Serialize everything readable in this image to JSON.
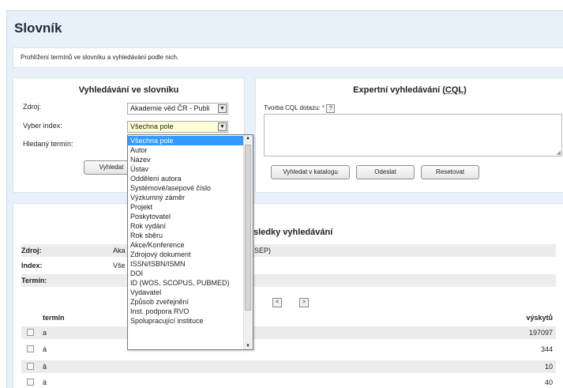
{
  "header": {
    "title": "Slovník"
  },
  "intro": {
    "text": "Prohlížení termínů ve slovníku a vyhledávání podle nich."
  },
  "simple_search": {
    "title": "Vyhledávání ve slovníku",
    "source_label": "Zdroj:",
    "source_value": "Akademie věd ČR - Publi",
    "index_label": "Vyber index:",
    "index_value": "Všechna pole",
    "term_label": "Hledaný termín:",
    "search_button": "Vyhledat"
  },
  "expert_search": {
    "title": "Expertní vyhledávání (",
    "title_abbr": "CQL",
    "title_end": ")",
    "query_label": "Tvorba CQL dotazu:",
    "required_mark": "*",
    "help_mark": "?",
    "search_catalog_button": "Vyhledat v katalogu",
    "submit_button": "Odeslat",
    "reset_button": "Resetovat"
  },
  "index_dropdown": {
    "options": [
      "Všechna pole",
      "Autor",
      "Název",
      "Ústav",
      "Oddělení autora",
      "Systémové/asepové číslo",
      "Výzkumný záměr",
      "Projekt",
      "Poskytovatel",
      "Rok vydání",
      "Rok sběru",
      "Akce/Konference",
      "Zdrojový dokument",
      "ISSN/ISBN/ISMN",
      "DOI",
      "ID (WOS, SCOPUS, PUBMED)",
      "Vydavatel",
      "Způsob zveřejnění",
      "Inst. podpora RVO",
      "Spolupracující instituce"
    ],
    "selected_fraction": 0
  },
  "results": {
    "title": "sledky vyhledávání",
    "source_label": "Zdroj:",
    "source_value": "Aka",
    "source_tail": "SEP)",
    "index_label": "Index:",
    "index_value": "Vše",
    "term_label": "Termín:",
    "nav_prev": "<",
    "nav_next": ">",
    "col_term": "termín",
    "col_count": "výskytů",
    "rows": [
      {
        "term": "a",
        "count": "197097"
      },
      {
        "term": "á",
        "count": "344"
      },
      {
        "term": "â",
        "count": "10"
      },
      {
        "term": "ä",
        "count": "40"
      }
    ]
  },
  "colors": {
    "accent": "#1f4e79",
    "page_bg": "#e8f1fa",
    "selection": "#3399ff"
  }
}
